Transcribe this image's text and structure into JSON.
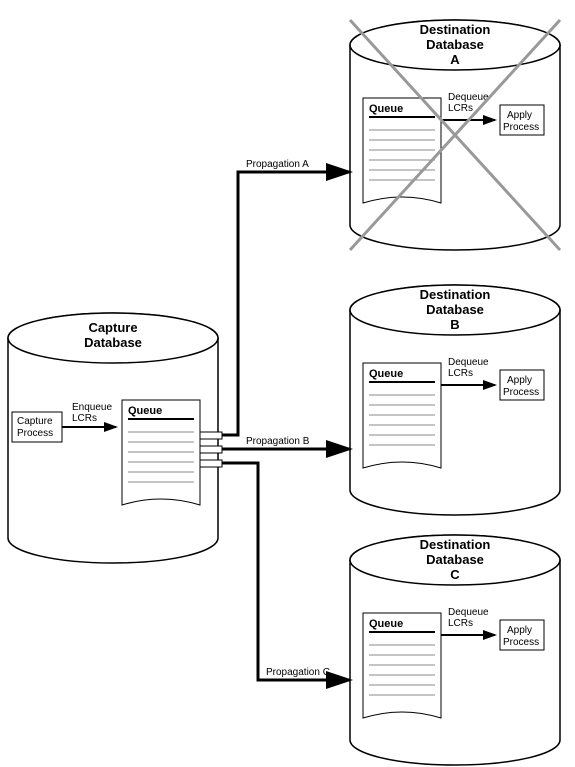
{
  "capture": {
    "title1": "Capture",
    "title2": "Database",
    "process": "Capture\nProcess",
    "enqueue": "Enqueue\nLCRs",
    "queue": "Queue"
  },
  "destA": {
    "title1": "Destination",
    "title2": "Database",
    "title3": "A",
    "queue": "Queue",
    "dequeue": "Dequeue\nLCRs",
    "apply": "Apply\nProcess"
  },
  "destB": {
    "title1": "Destination",
    "title2": "Database",
    "title3": "B",
    "queue": "Queue",
    "dequeue": "Dequeue\nLCRs",
    "apply": "Apply\nProcess"
  },
  "destC": {
    "title1": "Destination",
    "title2": "Database",
    "title3": "C",
    "queue": "Queue",
    "dequeue": "Dequeue\nLCRs",
    "apply": "Apply\nProcess"
  },
  "propA": "Propagation A",
  "propB": "Propagation B",
  "propC": "Propagation C"
}
